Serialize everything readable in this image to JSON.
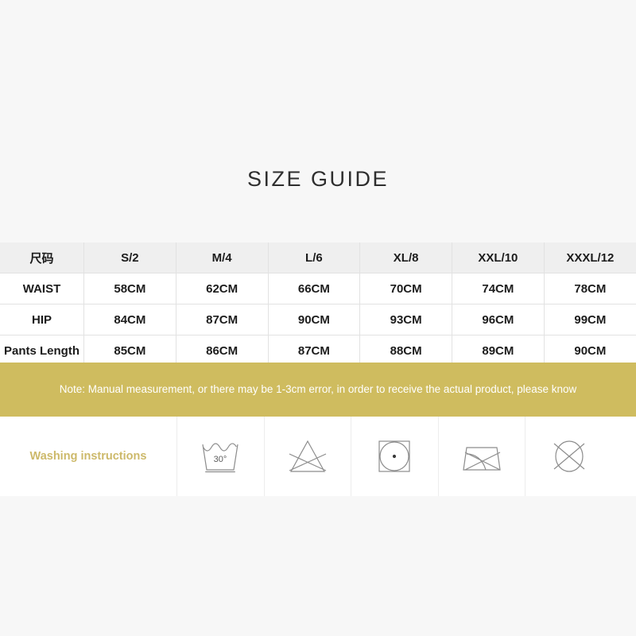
{
  "title": "SIZE GUIDE",
  "table": {
    "headers": [
      "尺码",
      "S/2",
      "M/4",
      "L/6",
      "XL/8",
      "XXL/10",
      "XXXL/12"
    ],
    "rows": [
      {
        "label": "WAIST",
        "values": [
          "58CM",
          "62CM",
          "66CM",
          "70CM",
          "74CM",
          "78CM"
        ]
      },
      {
        "label": "HIP",
        "values": [
          "84CM",
          "87CM",
          "90CM",
          "93CM",
          "96CM",
          "99CM"
        ]
      },
      {
        "label": "Pants Length",
        "values": [
          "85CM",
          "86CM",
          "87CM",
          "88CM",
          "89CM",
          "90CM"
        ]
      }
    ]
  },
  "note": {
    "text": "Note: Manual measurement, or there may be 1-3cm error, in order to receive the actual product, please know",
    "background_color": "#cfbc5f",
    "text_color": "#ffffff"
  },
  "washing": {
    "label": "Washing instructions",
    "label_color": "#cdb96a",
    "icons": [
      {
        "name": "wash-30-degrees-icon",
        "temperature": "30°"
      },
      {
        "name": "do-not-bleach-icon",
        "temperature": ""
      },
      {
        "name": "tumble-dry-low-icon",
        "temperature": ""
      },
      {
        "name": "do-not-iron-icon",
        "temperature": ""
      },
      {
        "name": "do-not-dry-clean-icon",
        "temperature": ""
      }
    ]
  },
  "colors": {
    "page_background": "#f7f7f7",
    "table_header_background": "#efefef",
    "table_border": "#e2e2e2",
    "accent_gold": "#cfbc5f"
  }
}
